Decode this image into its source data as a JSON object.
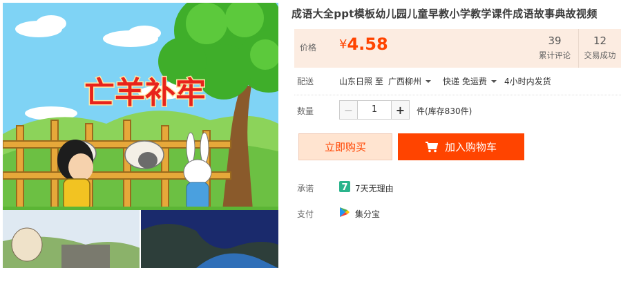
{
  "product": {
    "title": "成语大全ppt模板幼儿园儿童早教小学教学课件成语故事典故视频",
    "image_caption": "亡羊补牢"
  },
  "price": {
    "label": "价格",
    "currency": "¥",
    "value": "4.58"
  },
  "stats": {
    "reviews_count": "39",
    "reviews_label": "累计评论",
    "deals_count": "12",
    "deals_label": "交易成功"
  },
  "shipping": {
    "label": "配送",
    "from": "山东日照 至",
    "to": "广西柳州",
    "method": "快递 免运费",
    "dispatch": "4小时内发货"
  },
  "quantity": {
    "label": "数量",
    "minus": "−",
    "value": "1",
    "plus": "+",
    "stock": "件(库存830件)"
  },
  "actions": {
    "buy_now": "立即购买",
    "add_to_cart": "加入购物车"
  },
  "promise": {
    "label": "承诺",
    "badge": "7",
    "text": "7天无理由"
  },
  "payment": {
    "label": "支付",
    "text": "集分宝"
  },
  "colors": {
    "accent": "#ff4400",
    "price_bg": "#fcece1",
    "buy_bg": "#ffe4d0",
    "promise_badge": "#2ab48c"
  },
  "icons": {
    "cart": "cart-icon",
    "promise": "seven-day-return-icon",
    "payment": "play-store-icon"
  }
}
